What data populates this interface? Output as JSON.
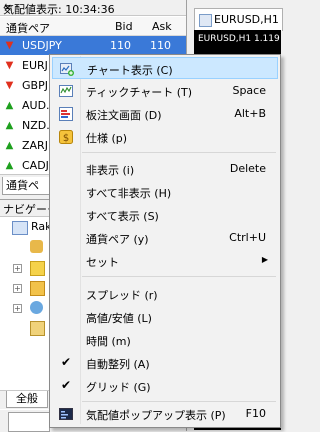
{
  "market_watch": {
    "title": "気配値表示: 10:34:36",
    "close": "×",
    "columns": {
      "symbol": "通貨ペア",
      "bid": "Bid",
      "ask": "Ask"
    },
    "rows": [
      {
        "symbol": "USDJPY",
        "bid": "110",
        "ask": "110",
        "dir": "down"
      },
      {
        "symbol": "EURJ",
        "dir": "down"
      },
      {
        "symbol": "GBPJ",
        "dir": "down"
      },
      {
        "symbol": "AUD...",
        "dir": "up"
      },
      {
        "symbol": "NZD...",
        "dir": "up"
      },
      {
        "symbol": "ZARJ",
        "dir": "up"
      },
      {
        "symbol": "CADJ",
        "dir": "up"
      }
    ],
    "tab": "通貨ペ"
  },
  "navigator": {
    "title": "ナビゲータ",
    "root": "Rak",
    "tab": "全般"
  },
  "chart": {
    "tab_label": "EURUSD,H1",
    "info": "EURUSD,H1  1.119"
  },
  "context_menu": {
    "items": [
      {
        "label": "チャート表示 (C)",
        "shortcut": ""
      },
      {
        "label": "ティックチャート (T)",
        "shortcut": "Space"
      },
      {
        "label": "板注文画面 (D)",
        "shortcut": "Alt+B"
      },
      {
        "label": "仕様 (p)",
        "shortcut": ""
      },
      {
        "label": "非表示 (i)",
        "shortcut": "Delete"
      },
      {
        "label": "すべて非表示 (H)",
        "shortcut": ""
      },
      {
        "label": "すべて表示 (S)",
        "shortcut": ""
      },
      {
        "label": "通貨ペア (y)",
        "shortcut": "Ctrl+U"
      },
      {
        "label": "セット",
        "shortcut": ""
      },
      {
        "label": "スプレッド (r)",
        "shortcut": ""
      },
      {
        "label": "高値/安値 (L)",
        "shortcut": ""
      },
      {
        "label": "時間 (m)",
        "shortcut": ""
      },
      {
        "label": "自動整列 (A)",
        "shortcut": ""
      },
      {
        "label": "グリッド (G)",
        "shortcut": ""
      },
      {
        "label": "気配値ポップアップ表示 (P)",
        "shortcut": "F10"
      }
    ],
    "check_mark": "✔",
    "submenu_arrow": "▶"
  },
  "colors": {
    "selection": "#3a79d8",
    "menu_highlight": "#cce8ff",
    "up": "#1ea01e",
    "down": "#e0301e"
  }
}
